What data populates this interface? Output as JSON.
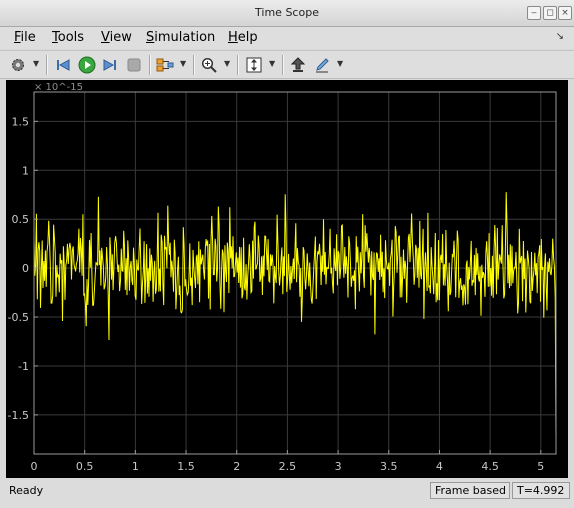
{
  "window": {
    "title": "Time Scope"
  },
  "menu": {
    "items": [
      {
        "mnemonic": "F",
        "rest": "ile"
      },
      {
        "mnemonic": "T",
        "rest": "ools"
      },
      {
        "mnemonic": "V",
        "rest": "iew"
      },
      {
        "mnemonic": "S",
        "rest": "imulation"
      },
      {
        "mnemonic": "H",
        "rest": "elp"
      }
    ]
  },
  "toolbar": {
    "icons": [
      "gear-icon",
      "step-back-icon",
      "run-icon",
      "step-forward-icon",
      "stop-icon",
      "signal-select-icon",
      "zoom-in-icon",
      "scale-axes-icon",
      "highlight-icon",
      "style-icon"
    ]
  },
  "status": {
    "text": "Ready",
    "mode": "Frame based",
    "time": "T=4.992"
  },
  "colors": {
    "trace": "#ffff00",
    "plot_bg": "#000000",
    "axes": "#9a9a9a",
    "grid": "#3a3a3a"
  },
  "chart_data": {
    "type": "line",
    "title": "",
    "xlabel": "",
    "ylabel": "",
    "y_exponent": "× 10^-15",
    "xlim": [
      0,
      5.15
    ],
    "ylim": [
      -1.9,
      1.8
    ],
    "grid": true,
    "x_ticks": [
      "0",
      "0.5",
      "1",
      "1.5",
      "2",
      "2.5",
      "3",
      "3.5",
      "4",
      "4.5",
      "5"
    ],
    "y_ticks": [
      "1.5",
      "1",
      "0.5",
      "0",
      "-0.5",
      "-1",
      "-1.5"
    ],
    "series": [
      {
        "color": "#ffff00",
        "sample_period": 0.008,
        "description": "noise",
        "values_seed": 20231105,
        "sigma": 0.33,
        "samples": 640
      }
    ]
  }
}
